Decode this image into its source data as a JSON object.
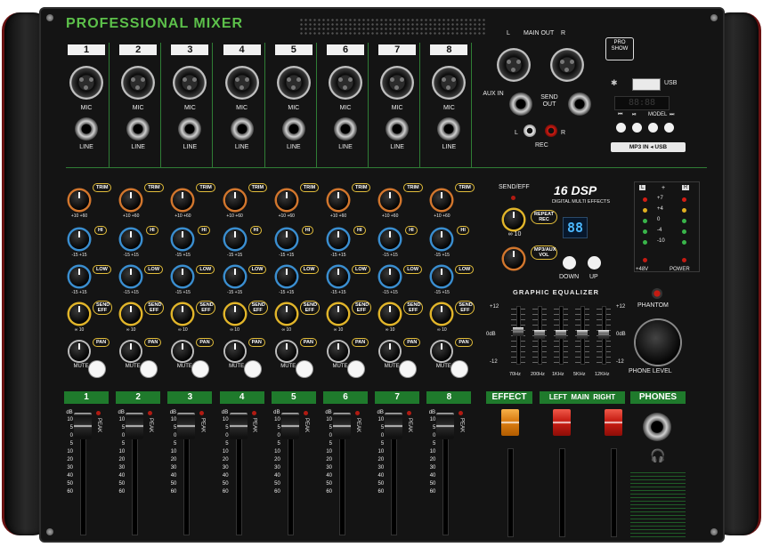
{
  "brand": {
    "title": "PROFESSIONAL  MIXER",
    "logo_top": "PRO",
    "logo_bottom": "SHOW"
  },
  "channels": [
    "1",
    "2",
    "3",
    "4",
    "5",
    "6",
    "7",
    "8"
  ],
  "labels": {
    "mic": "MIC",
    "line": "LINE",
    "trim": "TRIM",
    "hi": "HI",
    "low": "LOW",
    "send_eff": "SEND EFF",
    "pan": "PAN",
    "mute": "MUTE",
    "peak": "PEAK",
    "trim_range": "+10  +60",
    "eq_range": "-15  +15",
    "eff_range": "∞  10",
    "pan_range": "L  R"
  },
  "io": {
    "main_out": "MAIN OUT",
    "main_l": "L",
    "main_r": "R",
    "aux_in": "AUX IN",
    "send_out": "SEND OUT",
    "rec_l": "L",
    "rec_r": "R",
    "rec": "REC",
    "usb": "USB",
    "usb_display": "88:88",
    "model": "MODEL",
    "mp3_in": "MP3 IN",
    "usb_tag": "USB"
  },
  "dsp": {
    "send_eff": "SEND/EFF",
    "title": "16 DSP",
    "subtitle": "DIGITAL MULTI EFFECTS",
    "repeat": "REPEAT REC",
    "mp3_vol": "MP3/AUX VOL",
    "display": "88",
    "down": "DOWN",
    "up": "UP",
    "knob_range": "∞  10"
  },
  "geq": {
    "title": "GRAPHIC EQUALIZER",
    "scale_top": "+12",
    "scale_mid": "0dB",
    "scale_bot": "-12",
    "bands": [
      "70Hz",
      "200Hz",
      "1KHz",
      "5KHz",
      "12KHz"
    ],
    "levels": [
      0.55,
      0.5,
      0.5,
      0.5,
      0.5
    ]
  },
  "meter": {
    "l": "L",
    "plus": "+",
    "r": "R",
    "steps": [
      "+7",
      "+4",
      "0",
      "-4",
      "-10"
    ],
    "phantom_48": "+48V",
    "power": "POWER"
  },
  "phantom": {
    "label": "PHANTOM",
    "phone_level": "PHONE LEVEL"
  },
  "bottom": {
    "effect": "EFFECT",
    "left": "LEFT",
    "main": "MAIN",
    "right": "RIGHT",
    "phones": "PHONES",
    "db": "dB",
    "scale": [
      "10",
      "5",
      "0",
      "5",
      "10",
      "20",
      "30",
      "40",
      "50",
      "60"
    ]
  },
  "colors": {
    "green": "#1f7a2c",
    "accent_green": "#5cc04a",
    "fader_effect": "#e08a14",
    "fader_main": "#c51b12"
  }
}
